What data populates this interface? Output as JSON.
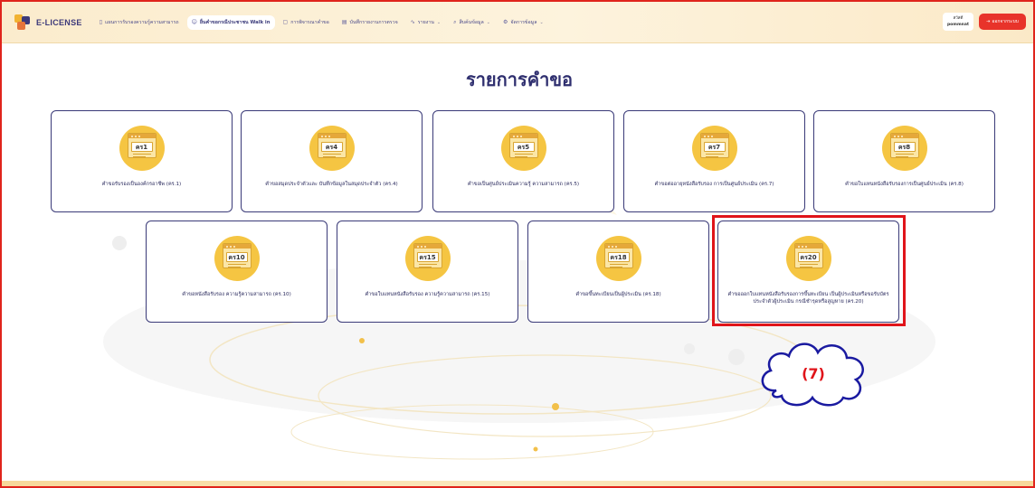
{
  "brand": {
    "name": "E-LICENSE"
  },
  "nav": [
    {
      "label": "แผนการรับรองความรู้ความสามารถ",
      "icon": "book-icon",
      "chevron": false,
      "active": false
    },
    {
      "label": "ยื่นคำขอกรณีประชาชน Walk in",
      "icon": "user-icon",
      "chevron": false,
      "active": true
    },
    {
      "label": "การพิจารณาคำขอ",
      "icon": "document-icon",
      "chevron": false,
      "active": false
    },
    {
      "label": "บันทึกรายงานการตรวจ",
      "icon": "file-icon",
      "chevron": false,
      "active": false
    },
    {
      "label": "รายงาน",
      "icon": "chart-line-icon",
      "chevron": true,
      "active": false
    },
    {
      "label": "สืบค้นข้อมูล",
      "icon": "search-icon",
      "chevron": true,
      "active": false
    },
    {
      "label": "จัดการข้อมูล",
      "icon": "gear-icon",
      "chevron": true,
      "active": false
    }
  ],
  "user": {
    "line1": "สวัสดี",
    "line2": "pommnat"
  },
  "logout": {
    "label": "ออกจากระบบ",
    "icon": "logout-icon"
  },
  "page_title": "รายการคำขอ",
  "cards": [
    {
      "code": "คร1",
      "caption": "คำขอรับรองเป็นองค์กรอาชีพ (คร.1)"
    },
    {
      "code": "คร4",
      "caption": "คำขอสมุดประจำตัวและ บันทึกข้อมูลในสมุดประจำตัว (คร.4)"
    },
    {
      "code": "คร5",
      "caption": "คำขอเป็นศูนย์ประเมินความรู้ ความสามารถ (คร.5)"
    },
    {
      "code": "คร7",
      "caption": "คำขอต่ออายุหนังสือรับรอง การเป็นศูนย์ประเมิน (คร.7)"
    },
    {
      "code": "คร8",
      "caption": "คำขอใบแทนหนังสือรับรองการเป็นศูนย์ประเมิน (คร.8)"
    },
    {
      "code": "คร10",
      "caption": "คำขอหนังสือรับรอง ความรู้ความสามารถ (คร.10)"
    },
    {
      "code": "คร15",
      "caption": "คำขอใบแทนหนังสือรับรอง ความรู้ความสามารถ (คร.15)"
    },
    {
      "code": "คร18",
      "caption": "คำขอขึ้นทะเบียนเป็นผู้ประเมิน (คร.18)"
    },
    {
      "code": "คร20",
      "caption": "คำขอออกใบแทนหนังสือรับรองการขึ้นทะเบียน เป็นผู้ประเมินหรือขอรับบัตรประจำตัวผู้ประเมิน กรณีชำรุดหรือสูญหาย (คร.20)"
    }
  ],
  "callout": {
    "label": "(7)"
  },
  "colors": {
    "accent": "#f5c542",
    "border": "#3a3a78",
    "highlight": "#e0141a",
    "logout": "#e8332a"
  }
}
